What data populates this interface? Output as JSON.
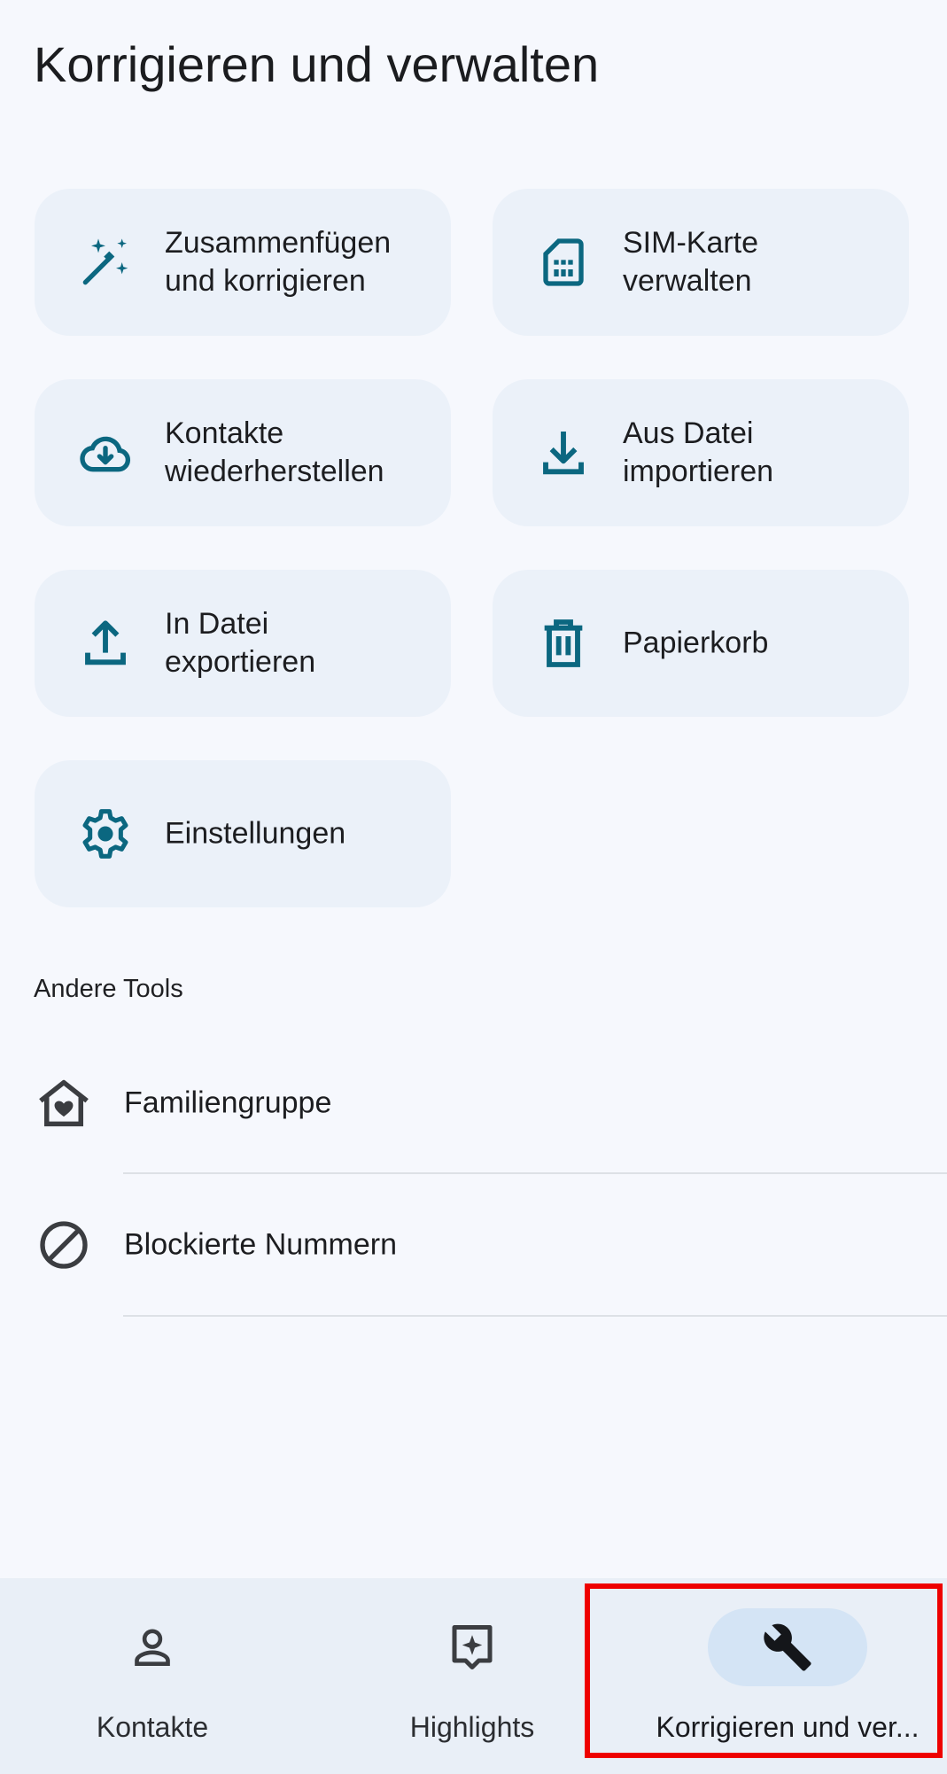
{
  "page": {
    "title": "Korrigieren und verwalten"
  },
  "tiles": [
    {
      "label": "Zusammenfügen\nund korrigieren",
      "icon": "magic-wand-icon"
    },
    {
      "label": "SIM-Karte\nverwalten",
      "icon": "sim-card-icon"
    },
    {
      "label": "Kontakte\nwiederherstellen",
      "icon": "cloud-download-icon"
    },
    {
      "label": "Aus Datei\nimportieren",
      "icon": "download-icon"
    },
    {
      "label": "In Datei\nexportieren",
      "icon": "upload-icon"
    },
    {
      "label": "Papierkorb",
      "icon": "trash-icon"
    },
    {
      "label": "Einstellungen",
      "icon": "gear-icon"
    }
  ],
  "other_tools": {
    "label": "Andere Tools",
    "items": [
      {
        "label": "Familiengruppe",
        "icon": "family-home-icon"
      },
      {
        "label": "Blockierte Nummern",
        "icon": "block-icon"
      }
    ]
  },
  "nav": {
    "items": [
      {
        "label": "Kontakte",
        "icon": "person-icon"
      },
      {
        "label": "Highlights",
        "icon": "highlights-icon"
      },
      {
        "label": "Korrigieren und ver...",
        "icon": "wrench-icon",
        "active": true
      }
    ]
  },
  "colors": {
    "accent": "#0b6780",
    "tile_bg": "#ebf1f9",
    "background": "#f6f8fd",
    "nav_bg": "#e9eff7",
    "active_pill": "#d4e4f5",
    "highlight": "#ee0000"
  }
}
